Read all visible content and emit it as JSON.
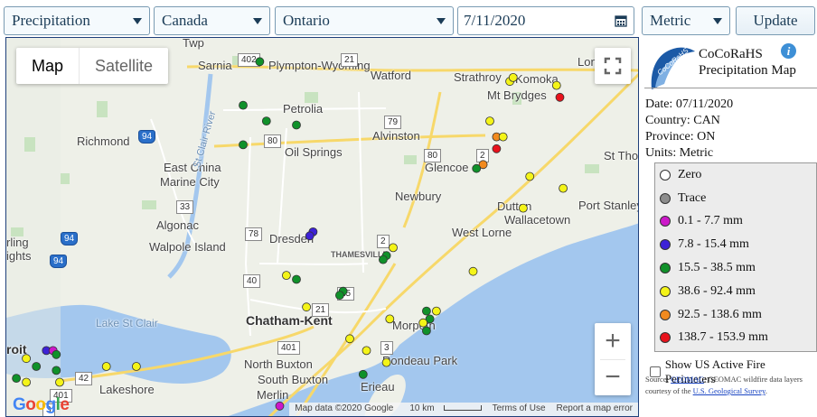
{
  "toolbar": {
    "type_select": "Precipitation",
    "country_select": "Canada",
    "province_select": "Ontario",
    "date_value": "7/11/2020",
    "units_select": "Metric",
    "update_label": "Update"
  },
  "map": {
    "maptype_map": "Map",
    "maptype_satellite": "Satellite",
    "zoom_in": "+",
    "zoom_out": "−",
    "attribution": {
      "data": "Map data ©2020 Google",
      "scale": "10 km",
      "terms": "Terms of Use",
      "report": "Report a map error"
    },
    "labels": [
      {
        "text": "Twp",
        "cls": "big"
      },
      {
        "text": "Sarnia",
        "cls": "big"
      },
      {
        "text": "Plympton-Wyoming",
        "cls": "big"
      },
      {
        "text": "Watford",
        "cls": "big"
      },
      {
        "text": "Strathroy",
        "cls": "big"
      },
      {
        "text": "Komoka",
        "cls": "big"
      },
      {
        "text": "Lon",
        "cls": "big"
      },
      {
        "text": "Mt Brydges",
        "cls": "big"
      },
      {
        "text": "Petrolia",
        "cls": "big"
      },
      {
        "text": "Alvinston",
        "cls": "big"
      },
      {
        "text": "Richmond",
        "cls": "big"
      },
      {
        "text": "Oil Springs",
        "cls": "big"
      },
      {
        "text": "East China",
        "cls": "big"
      },
      {
        "text": "Marine City",
        "cls": "big"
      },
      {
        "text": "Glencoe",
        "cls": "big"
      },
      {
        "text": "St Thomas",
        "cls": "big"
      },
      {
        "text": "Newbury",
        "cls": "big"
      },
      {
        "text": "Dutton",
        "cls": "big"
      },
      {
        "text": "Wallacetown",
        "cls": "big"
      },
      {
        "text": "Port Stanley",
        "cls": "big"
      },
      {
        "text": "Algonac",
        "cls": "big"
      },
      {
        "text": "Walpole Island",
        "cls": "big"
      },
      {
        "text": "Dresden",
        "cls": "big"
      },
      {
        "text": "West Lorne",
        "cls": "big"
      },
      {
        "text": "rling",
        "cls": "big"
      },
      {
        "text": "ights",
        "cls": "big"
      },
      {
        "text": "THAMESVILLE",
        "cls": ""
      },
      {
        "text": "Lake St Clair",
        "cls": "water"
      },
      {
        "text": "Chatham-Kent",
        "cls": "city"
      },
      {
        "text": "Morpeth",
        "cls": "big"
      },
      {
        "text": "North Buxton",
        "cls": "big"
      },
      {
        "text": "Rondeau Park",
        "cls": "big"
      },
      {
        "text": "South Buxton",
        "cls": "big"
      },
      {
        "text": "Lakeshore",
        "cls": "big"
      },
      {
        "text": "Merlin",
        "cls": "big"
      },
      {
        "text": "Erieau",
        "cls": "big"
      },
      {
        "text": "roit",
        "cls": "city"
      },
      {
        "text": "St Clair River",
        "cls": "river"
      }
    ],
    "shields": [
      {
        "text": "402",
        "cls": ""
      },
      {
        "text": "21",
        "cls": ""
      },
      {
        "text": "79",
        "cls": ""
      },
      {
        "text": "80",
        "cls": ""
      },
      {
        "text": "80",
        "cls": ""
      },
      {
        "text": "2",
        "cls": ""
      },
      {
        "text": "94",
        "cls": "us"
      },
      {
        "text": "33",
        "cls": ""
      },
      {
        "text": "78",
        "cls": ""
      },
      {
        "text": "2",
        "cls": ""
      },
      {
        "text": "94",
        "cls": "us"
      },
      {
        "text": "94",
        "cls": "us"
      },
      {
        "text": "40",
        "cls": ""
      },
      {
        "text": "15",
        "cls": ""
      },
      {
        "text": "21",
        "cls": ""
      },
      {
        "text": "401",
        "cls": ""
      },
      {
        "text": "3",
        "cls": ""
      },
      {
        "text": "42",
        "cls": ""
      },
      {
        "text": "401",
        "cls": ""
      },
      {
        "text": "3",
        "cls": ""
      }
    ]
  },
  "stations": [
    {
      "lon": -82.34,
      "lat": 43.02,
      "cat": "green"
    },
    {
      "lon": -82.39,
      "lat": 42.91,
      "cat": "green"
    },
    {
      "lon": -82.32,
      "lat": 42.87,
      "cat": "green"
    },
    {
      "lon": -82.23,
      "lat": 42.86,
      "cat": "green"
    },
    {
      "lon": -82.39,
      "lat": 42.81,
      "cat": "green"
    },
    {
      "lon": -81.59,
      "lat": 42.97,
      "cat": "yellow"
    },
    {
      "lon": -81.58,
      "lat": 42.98,
      "cat": "yellow"
    },
    {
      "lon": -81.45,
      "lat": 42.96,
      "cat": "yellow"
    },
    {
      "lon": -81.44,
      "lat": 42.93,
      "cat": "red"
    },
    {
      "lon": -81.65,
      "lat": 42.87,
      "cat": "yellow"
    },
    {
      "lon": -81.63,
      "lat": 42.83,
      "cat": "orange"
    },
    {
      "lon": -81.61,
      "lat": 42.83,
      "cat": "yellow"
    },
    {
      "lon": -81.63,
      "lat": 42.8,
      "cat": "red"
    },
    {
      "lon": -81.67,
      "lat": 42.76,
      "cat": "orange"
    },
    {
      "lon": -81.69,
      "lat": 42.75,
      "cat": "green"
    },
    {
      "lon": -81.53,
      "lat": 42.73,
      "cat": "yellow"
    },
    {
      "lon": -81.43,
      "lat": 42.7,
      "cat": "yellow"
    },
    {
      "lon": -81.55,
      "lat": 42.65,
      "cat": "yellow"
    },
    {
      "lon": -82.18,
      "lat": 42.59,
      "cat": "blue"
    },
    {
      "lon": -82.19,
      "lat": 42.58,
      "cat": "blue"
    },
    {
      "lon": -81.94,
      "lat": 42.55,
      "cat": "yellow"
    },
    {
      "lon": -81.96,
      "lat": 42.53,
      "cat": "green"
    },
    {
      "lon": -81.97,
      "lat": 42.52,
      "cat": "green"
    },
    {
      "lon": -81.7,
      "lat": 42.49,
      "cat": "yellow"
    },
    {
      "lon": -82.26,
      "lat": 42.48,
      "cat": "yellow"
    },
    {
      "lon": -82.23,
      "lat": 42.47,
      "cat": "green"
    },
    {
      "lon": -82.09,
      "lat": 42.44,
      "cat": "green"
    },
    {
      "lon": -82.1,
      "lat": 42.43,
      "cat": "green"
    },
    {
      "lon": -82.2,
      "lat": 42.4,
      "cat": "yellow"
    },
    {
      "lon": -81.95,
      "lat": 42.37,
      "cat": "yellow"
    },
    {
      "lon": -81.81,
      "lat": 42.39,
      "cat": "yellow"
    },
    {
      "lon": -81.83,
      "lat": 42.37,
      "cat": "green"
    },
    {
      "lon": -81.84,
      "lat": 42.39,
      "cat": "green"
    },
    {
      "lon": -81.85,
      "lat": 42.36,
      "cat": "yellow"
    },
    {
      "lon": -81.84,
      "lat": 42.34,
      "cat": "green"
    },
    {
      "lon": -82.07,
      "lat": 42.32,
      "cat": "yellow"
    },
    {
      "lon": -82.02,
      "lat": 42.29,
      "cat": "yellow"
    },
    {
      "lon": -81.96,
      "lat": 42.26,
      "cat": "yellow"
    },
    {
      "lon": -82.03,
      "lat": 42.23,
      "cat": "green"
    },
    {
      "lon": -82.98,
      "lat": 42.29,
      "cat": "blue"
    },
    {
      "lon": -82.96,
      "lat": 42.29,
      "cat": "purple"
    },
    {
      "lon": -82.95,
      "lat": 42.28,
      "cat": "green"
    },
    {
      "lon": -83.04,
      "lat": 42.27,
      "cat": "yellow"
    },
    {
      "lon": -83.01,
      "lat": 42.25,
      "cat": "green"
    },
    {
      "lon": -82.95,
      "lat": 42.24,
      "cat": "green"
    },
    {
      "lon": -82.8,
      "lat": 42.25,
      "cat": "yellow"
    },
    {
      "lon": -82.71,
      "lat": 42.25,
      "cat": "yellow"
    },
    {
      "lon": -82.94,
      "lat": 42.21,
      "cat": "yellow"
    },
    {
      "lon": -83.04,
      "lat": 42.21,
      "cat": "yellow"
    },
    {
      "lon": -83.07,
      "lat": 42.22,
      "cat": "green"
    },
    {
      "lon": -82.28,
      "lat": 42.15,
      "cat": "purple"
    }
  ],
  "categories": {
    "zero": {
      "color": "#ffffff"
    },
    "trace": {
      "color": "#8c8c8c"
    },
    "purple": {
      "color": "#cc18c9"
    },
    "blue": {
      "color": "#3d22d6"
    },
    "green": {
      "color": "#10912a"
    },
    "yellow": {
      "color": "#f4f418"
    },
    "orange": {
      "color": "#f28a1e"
    },
    "red": {
      "color": "#e8121c"
    }
  },
  "panel": {
    "title_line1": "CoCoRaHS",
    "title_line2": "Precipitation Map",
    "logo_text": "CoCoRaHS",
    "info_icon": "i",
    "date_line": "Date: 07/11/2020",
    "country_line": "Country: CAN",
    "province_line": "Province: ON",
    "units_line": "Units: Metric",
    "legend": [
      {
        "label": "Zero",
        "color": "#ffffff"
      },
      {
        "label": "Trace",
        "color": "#8c8c8c"
      },
      {
        "label": "0.1 - 7.7 mm",
        "color": "#cc18c9"
      },
      {
        "label": "7.8 - 15.4 mm",
        "color": "#3d22d6"
      },
      {
        "label": "15.5 - 38.5 mm",
        "color": "#10912a"
      },
      {
        "label": "38.6 - 92.4 mm",
        "color": "#f4f418"
      },
      {
        "label": "92.5 - 138.6 mm",
        "color": "#f28a1e"
      },
      {
        "label": "138.7 - 153.9 mm",
        "color": "#e8121c"
      }
    ],
    "fire_label": "Show US Active Fire Perimeters",
    "source_prefix": "Source: ",
    "source_link1": "GEOMAC",
    "source_mid": ": GEOMAC wildfire data layers courtesy of the ",
    "source_link2": "U.S. Geological Survey",
    "source_suffix": "."
  }
}
